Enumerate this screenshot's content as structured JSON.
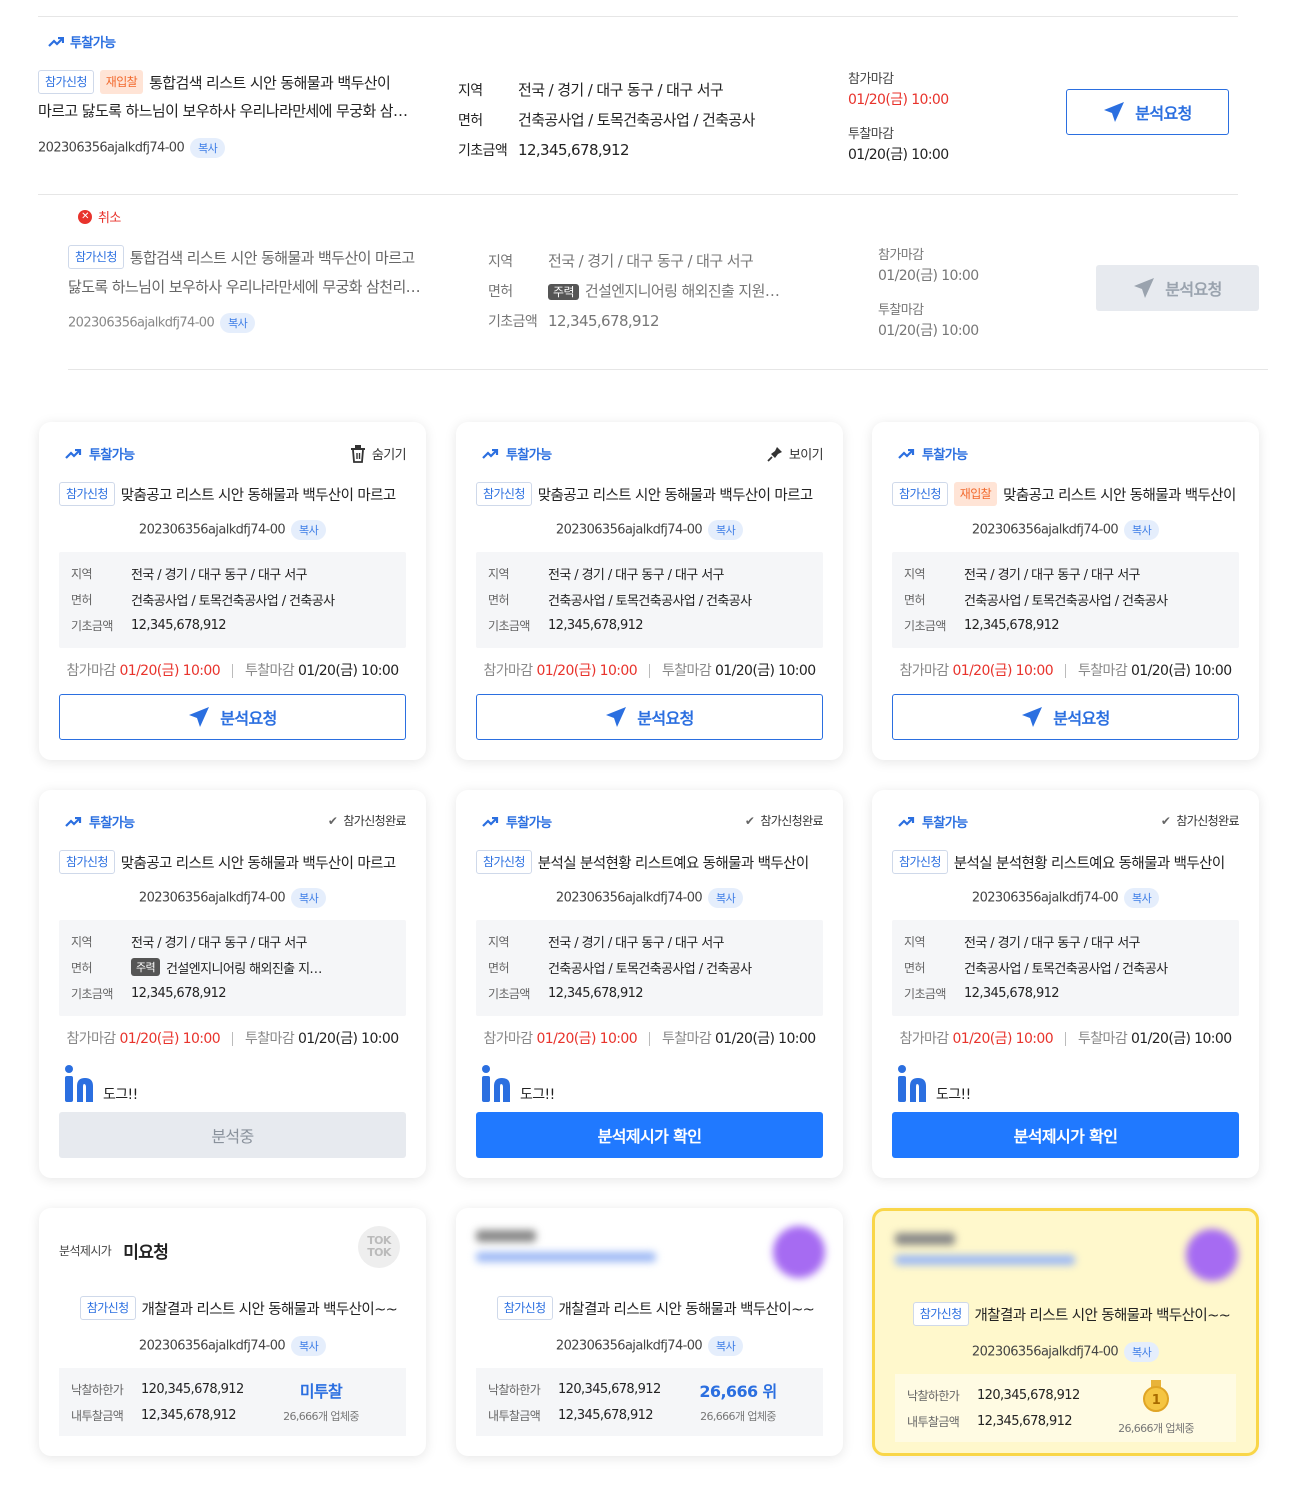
{
  "list": {
    "item1": {
      "status": "투찰가능",
      "badge": "참가신청",
      "badge_re": "재입찰",
      "title_line1": "통합검색 리스트 시안 동해물과 백두산이",
      "title_line2": "마르고 닳도록 하느님이 보우하사 우리나라만세에 무궁화 삼…",
      "id": "202306356ajalkdfj74-00",
      "copy": "복사",
      "region_label": "지역",
      "region": "전국 / 경기 / 대구 동구 / 대구 서구",
      "license_label": "면허",
      "license": "건축공사업 / 토목건축공사업 / 건축공사",
      "base_label": "기초금액",
      "base": "12,345,678,912",
      "join_deadline_label": "참가마감",
      "join_deadline": "01/20(금) 10:00",
      "bid_deadline_label": "투찰마감",
      "bid_deadline": "01/20(금) 10:00",
      "button": "분석요청"
    },
    "item2": {
      "status": "취소",
      "badge": "참가신청",
      "title_line1": "통합검색 리스트 시안 동해물과 백두산이 마르고",
      "title_line2": "닳도록 하느님이 보우하사 우리나라만세에 무궁화 삼천리…",
      "id": "202306356ajalkdfj74-00",
      "copy": "복사",
      "region_label": "지역",
      "region": "전국 / 경기 / 대구 동구 / 대구 서구",
      "license_label": "면허",
      "license_tag": "주력",
      "license": "건설엔지니어링 해외진출 지원…",
      "base_label": "기초금액",
      "base": "12,345,678,912",
      "join_deadline_label": "참가마감",
      "join_deadline": "01/20(금) 10:00",
      "bid_deadline_label": "투찰마감",
      "bid_deadline": "01/20(금) 10:00",
      "button": "분석요청"
    }
  },
  "cards_row1": [
    {
      "status": "투찰가능",
      "right": "숨기기",
      "badge": "참가신청",
      "badge_re": "",
      "title": "맞춤공고 리스트 시안 동해물과 백두산이 마르고",
      "id": "202306356ajalkdfj74-00",
      "copy": "복사",
      "region_label": "지역",
      "region": "전국 / 경기 / 대구 동구 / 대구 서구",
      "license_label": "면허",
      "license": "건축공사업 / 토목건축공사업 / 건축공사",
      "base_label": "기초금액",
      "base": "12,345,678,912",
      "join_label": "참가마감",
      "join": "01/20(금) 10:00",
      "bid_label": "투찰마감",
      "bid": "01/20(금) 10:00",
      "button": "분석요청"
    },
    {
      "status": "투찰가능",
      "right": "보이기",
      "badge": "참가신청",
      "badge_re": "",
      "title": "맞춤공고 리스트 시안 동해물과 백두산이 마르고",
      "id": "202306356ajalkdfj74-00",
      "copy": "복사",
      "region_label": "지역",
      "region": "전국 / 경기 / 대구 동구 / 대구 서구",
      "license_label": "면허",
      "license": "건축공사업 / 토목건축공사업 / 건축공사",
      "base_label": "기초금액",
      "base": "12,345,678,912",
      "join_label": "참가마감",
      "join": "01/20(금) 10:00",
      "bid_label": "투찰마감",
      "bid": "01/20(금) 10:00",
      "button": "분석요청"
    },
    {
      "status": "투찰가능",
      "right": "",
      "badge": "참가신청",
      "badge_re": "재입찰",
      "title": "맞춤공고 리스트 시안 동해물과 백두산이",
      "id": "202306356ajalkdfj74-00",
      "copy": "복사",
      "region_label": "지역",
      "region": "전국 / 경기 / 대구 동구 / 대구 서구",
      "license_label": "면허",
      "license": "건축공사업 / 토목건축공사업 / 건축공사",
      "base_label": "기초금액",
      "base": "12,345,678,912",
      "join_label": "참가마감",
      "join": "01/20(금) 10:00",
      "bid_label": "투찰마감",
      "bid": "01/20(금) 10:00",
      "button": "분석요청"
    }
  ],
  "cards_row2": [
    {
      "status": "투찰가능",
      "right": "참가신청완료",
      "badge": "참가신청",
      "title": "맞춤공고 리스트 시안 동해물과 백두산이 마르고",
      "id": "202306356ajalkdfj74-00",
      "copy": "복사",
      "region_label": "지역",
      "region": "전국 / 경기 / 대구 동구 / 대구 서구",
      "license_label": "면허",
      "license_tag": "주력",
      "license": "건설엔지니어링 해외진출 지…",
      "base_label": "기초금액",
      "base": "12,345,678,912",
      "join_label": "참가마감",
      "join": "01/20(금) 10:00",
      "bid_label": "투찰마감",
      "bid": "01/20(금) 10:00",
      "user": "도그!!",
      "button": "분석중"
    },
    {
      "status": "투찰가능",
      "right": "참가신청완료",
      "badge": "참가신청",
      "title": "분석실 분석현황 리스트예요 동해물과 백두산이",
      "id": "202306356ajalkdfj74-00",
      "copy": "복사",
      "region_label": "지역",
      "region": "전국 / 경기 / 대구 동구 / 대구 서구",
      "license_label": "면허",
      "license_tag": "",
      "license": "건축공사업 / 토목건축공사업 / 건축공사",
      "base_label": "기초금액",
      "base": "12,345,678,912",
      "join_label": "참가마감",
      "join": "01/20(금) 10:00",
      "bid_label": "투찰마감",
      "bid": "01/20(금) 10:00",
      "user": "도그!!",
      "button": "분석제시가 확인"
    },
    {
      "status": "투찰가능",
      "right": "참가신청완료",
      "badge": "참가신청",
      "title": "분석실 분석현황 리스트예요 동해물과 백두산이",
      "id": "202306356ajalkdfj74-00",
      "copy": "복사",
      "region_label": "지역",
      "region": "전국 / 경기 / 대구 동구 / 대구 서구",
      "license_label": "면허",
      "license_tag": "",
      "license": "건축공사업 / 토목건축공사업 / 건축공사",
      "base_label": "기초금액",
      "base": "12,345,678,912",
      "join_label": "참가마감",
      "join": "01/20(금) 10:00",
      "bid_label": "투찰마감",
      "bid": "01/20(금) 10:00",
      "user": "도그!!",
      "button": "분석제시가 확인"
    }
  ],
  "cards_row3": [
    {
      "price_label": "분석제시가",
      "price_value": "미요청",
      "logo": "TOK TOK",
      "badge": "참가신청",
      "title": "개찰결과 리스트 시안 동해물과 백두산이~~",
      "id": "202306356ajalkdfj74-00",
      "copy": "복사",
      "lower_label": "낙찰하한가",
      "lower": "120,345,678,912",
      "my_label": "내투찰금액",
      "my": "12,345,678,912",
      "rank": "미투찰",
      "count": "26,666개 업체중"
    },
    {
      "badge": "참가신청",
      "title": "개찰결과 리스트 시안 동해물과 백두산이~~",
      "id": "202306356ajalkdfj74-00",
      "copy": "복사",
      "lower_label": "낙찰하한가",
      "lower": "120,345,678,912",
      "my_label": "내투찰금액",
      "my": "12,345,678,912",
      "rank": "26,666 위",
      "count": "26,666개 업체중"
    },
    {
      "badge": "참가신청",
      "title": "개찰결과 리스트 시안 동해물과 백두산이~~",
      "id": "202306356ajalkdfj74-00",
      "copy": "복사",
      "lower_label": "낙찰하한가",
      "lower": "120,345,678,912",
      "my_label": "내투찰금액",
      "my": "12,345,678,912",
      "medal": "1",
      "count": "26,666개 업체중"
    }
  ],
  "colors": {
    "accent": "#2b6fe0",
    "button_blue": "#2079ff",
    "red": "#e8332c",
    "highlight": "#fff8cc"
  }
}
